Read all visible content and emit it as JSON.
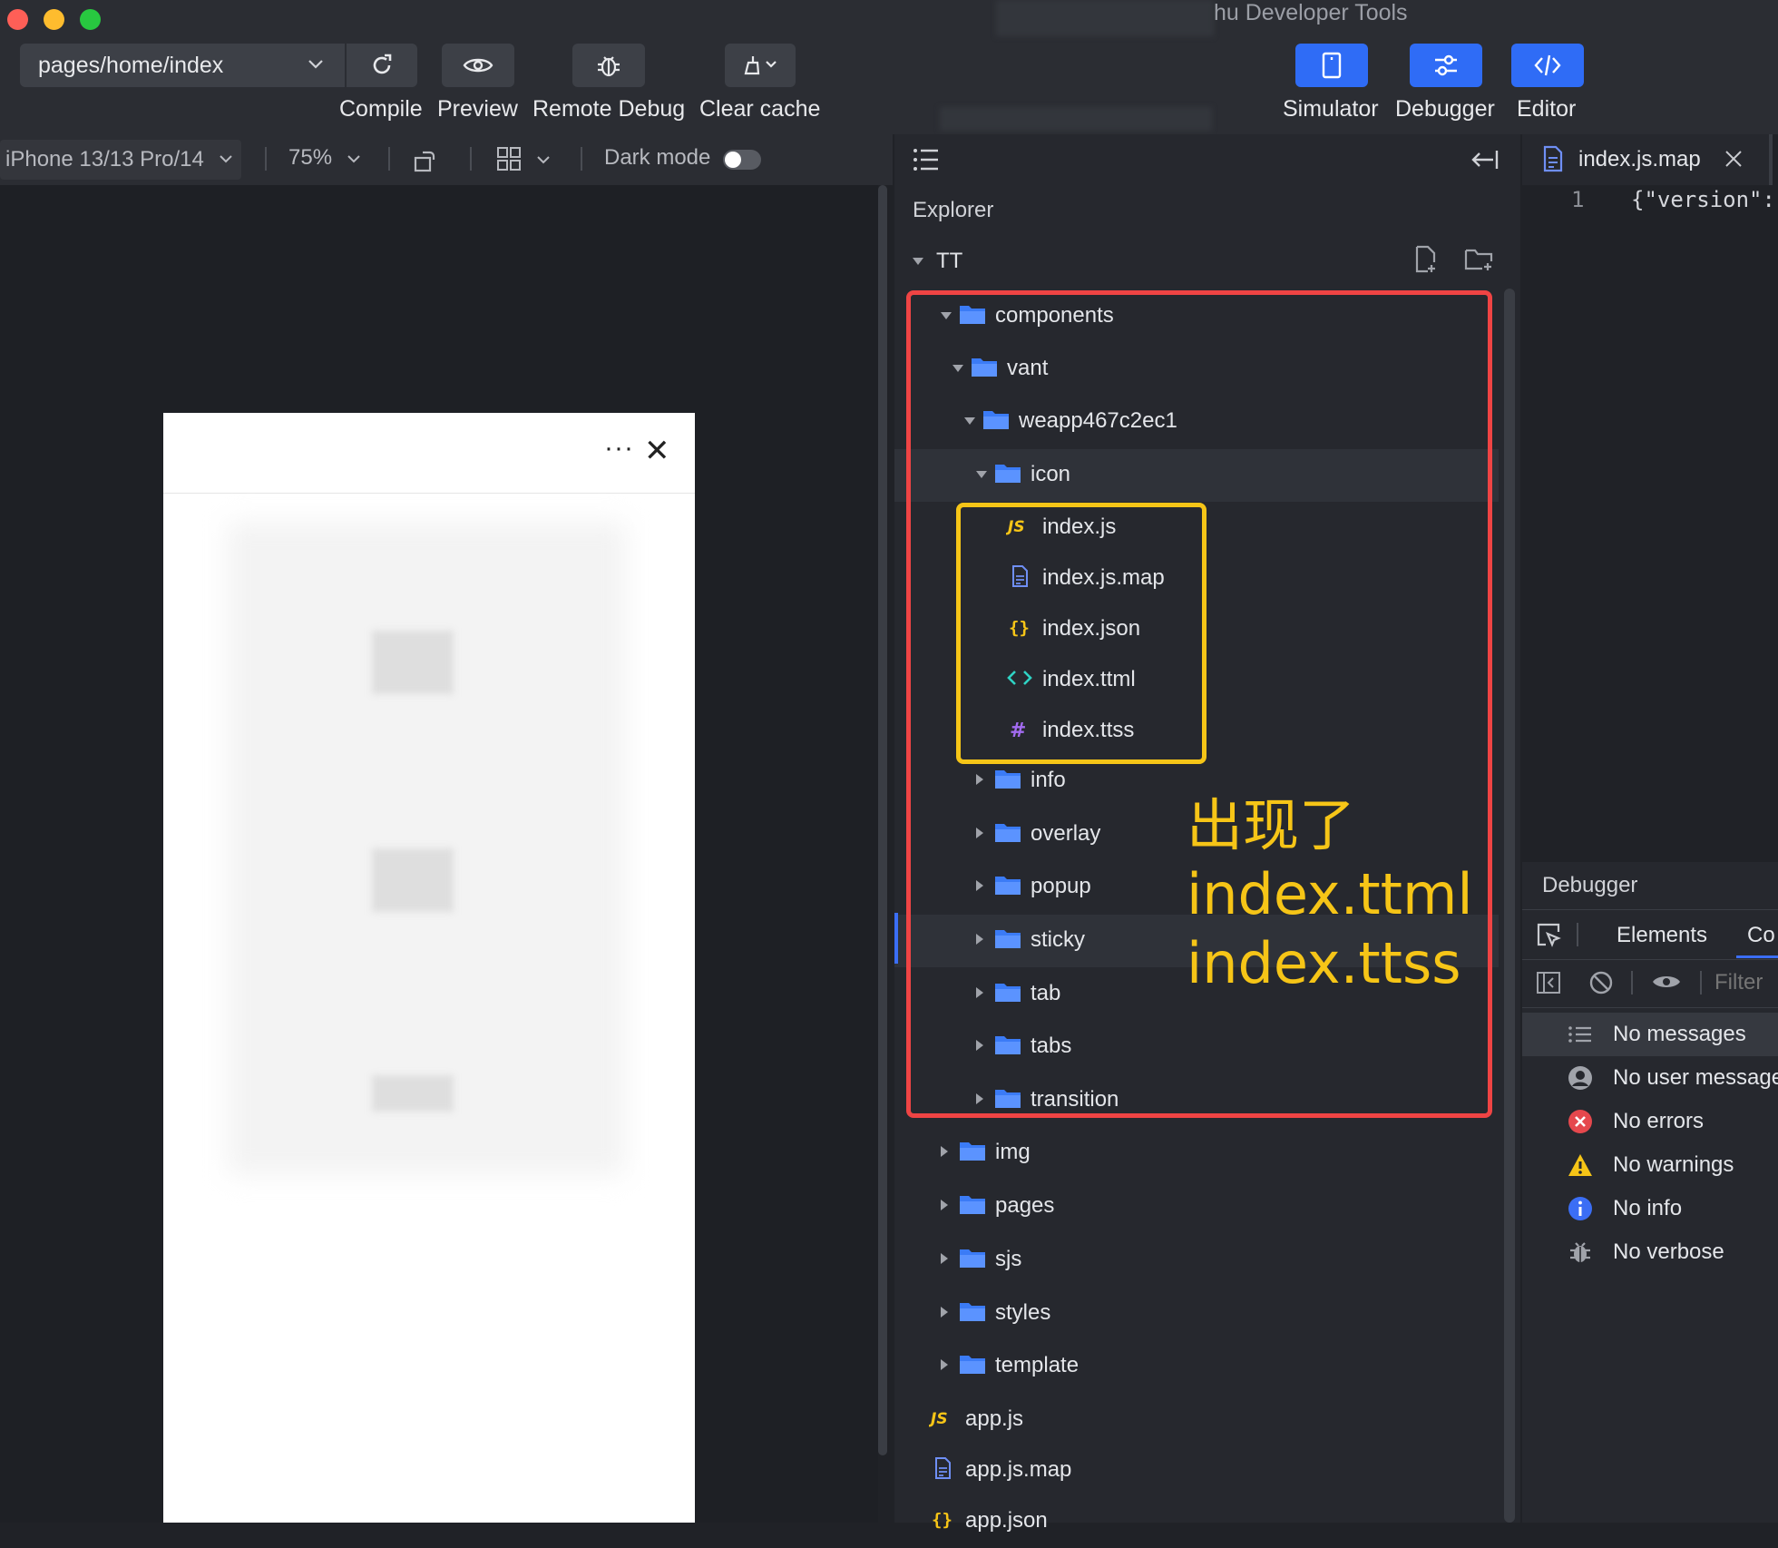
{
  "window": {
    "title": "hu Developer Tools"
  },
  "toolbar": {
    "page_path": "pages/home/index",
    "compile": "Compile",
    "preview": "Preview",
    "remote_debug": "Remote Debug",
    "clear_cache": "Clear cache",
    "simulator": "Simulator",
    "debugger": "Debugger",
    "editor": "Editor"
  },
  "simulator_bar": {
    "device": "iPhone 13/13 Pro/14",
    "zoom": "75%",
    "dark_mode_label": "Dark mode",
    "dark_mode_on": false
  },
  "phone": {
    "more": "···",
    "close": "✕"
  },
  "explorer": {
    "title": "Explorer",
    "root": "TT",
    "tree": [
      {
        "label": "components",
        "kind": "folder",
        "expanded": true
      },
      {
        "label": "vant",
        "kind": "folder",
        "expanded": true
      },
      {
        "label": "weapp467c2ec1",
        "kind": "folder",
        "expanded": true
      },
      {
        "label": "icon",
        "kind": "folder",
        "expanded": true
      },
      {
        "label": "index.js",
        "kind": "js"
      },
      {
        "label": "index.js.map",
        "kind": "map"
      },
      {
        "label": "index.json",
        "kind": "json"
      },
      {
        "label": "index.ttml",
        "kind": "ttml"
      },
      {
        "label": "index.ttss",
        "kind": "ttss"
      },
      {
        "label": "info",
        "kind": "folder",
        "expanded": false
      },
      {
        "label": "overlay",
        "kind": "folder",
        "expanded": false
      },
      {
        "label": "popup",
        "kind": "folder",
        "expanded": false
      },
      {
        "label": "sticky",
        "kind": "folder",
        "expanded": false
      },
      {
        "label": "tab",
        "kind": "folder",
        "expanded": false
      },
      {
        "label": "tabs",
        "kind": "folder",
        "expanded": false
      },
      {
        "label": "transition",
        "kind": "folder",
        "expanded": false
      },
      {
        "label": "img",
        "kind": "folder",
        "expanded": false
      },
      {
        "label": "pages",
        "kind": "folder",
        "expanded": false
      },
      {
        "label": "sjs",
        "kind": "folder",
        "expanded": false
      },
      {
        "label": "styles",
        "kind": "folder",
        "expanded": false
      },
      {
        "label": "template",
        "kind": "folder",
        "expanded": false
      },
      {
        "label": "app.js",
        "kind": "js"
      },
      {
        "label": "app.js.map",
        "kind": "map"
      },
      {
        "label": "app.json",
        "kind": "json"
      }
    ]
  },
  "annotation": {
    "line1": "出现了",
    "line2": "index.ttml",
    "line3": "index.ttss",
    "color": "#f6c517"
  },
  "editor": {
    "tab_label": "index.js.map",
    "line_number": "1",
    "code": "{\"version\":"
  },
  "debugger": {
    "title": "Debugger",
    "tabs": [
      "Elements",
      "Co"
    ],
    "filter_placeholder": "Filter",
    "messages": [
      {
        "label": "No messages",
        "icon": "list-icon"
      },
      {
        "label": "No user message",
        "icon": "user-icon"
      },
      {
        "label": "No errors",
        "icon": "error-icon"
      },
      {
        "label": "No warnings",
        "icon": "warning-icon"
      },
      {
        "label": "No info",
        "icon": "info-icon"
      },
      {
        "label": "No verbose",
        "icon": "bug-icon"
      }
    ]
  },
  "colors": {
    "accent_blue": "#2f6cf6",
    "highlight_red": "#ef4444",
    "highlight_yellow": "#f6c517",
    "folder_blue": "#3b7bf6"
  }
}
